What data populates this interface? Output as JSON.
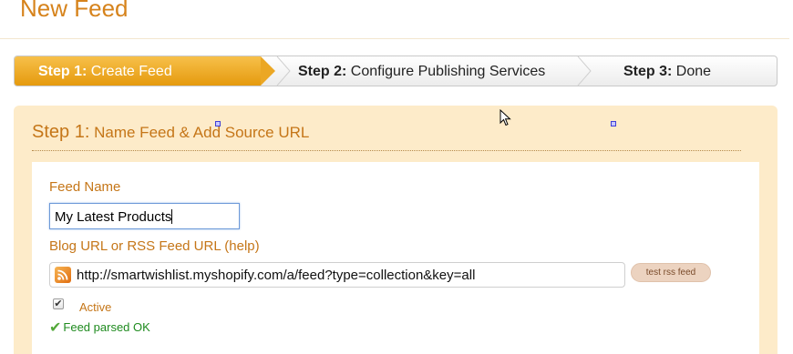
{
  "page": {
    "title": "New Feed"
  },
  "steps": [
    {
      "num": "Step 1:",
      "label": " Create Feed"
    },
    {
      "num": "Step 2:",
      "label": " Configure Publishing Services"
    },
    {
      "num": "Step 3:",
      "label": " Done"
    }
  ],
  "panel": {
    "heading_step": "Step 1:",
    "heading_text": " Name Feed & Add Source URL"
  },
  "form": {
    "feed_name_label": "Feed Name",
    "feed_name_value": "My Latest Products",
    "url_label": "Blog URL or RSS Feed URL (help)",
    "url_value": "http://smartwishlist.myshopify.com/a/feed?type=collection&key=all",
    "test_button": "test rss feed",
    "active_label": "Active",
    "active_checked": true,
    "status_text": "Feed parsed OK"
  },
  "colors": {
    "accent": "#d6831c",
    "active_step": "#eba724",
    "panel_bg": "#fdebc9",
    "ok_green": "#1f8b1f"
  },
  "icons": [
    "rss-icon",
    "checkmark-icon",
    "mouse-cursor-icon"
  ]
}
